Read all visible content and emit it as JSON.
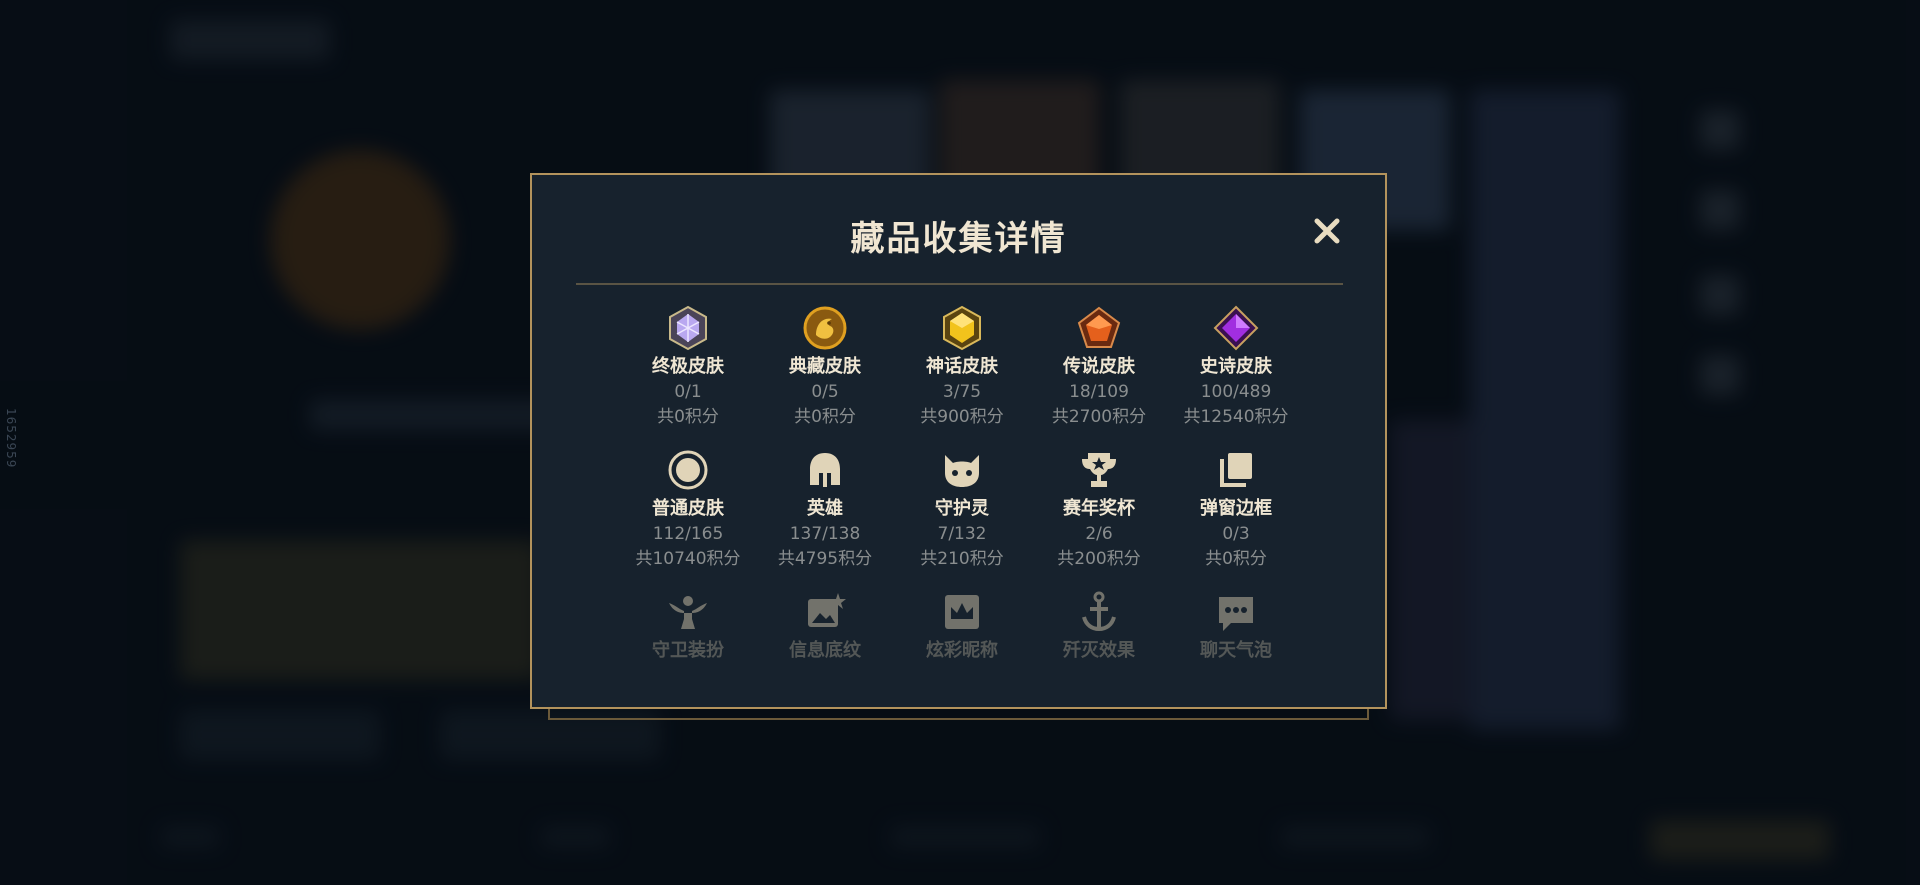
{
  "side_id": "1652959",
  "modal": {
    "title": "藏品收集详情",
    "close_icon": "close-icon"
  },
  "categories": [
    {
      "name": "终极皮肤",
      "count": "0/1",
      "points": "共0积分",
      "icon": "ultimate-gem-icon",
      "color": "#b9a8f0"
    },
    {
      "name": "典藏皮肤",
      "count": "0/5",
      "points": "共0积分",
      "icon": "dragon-coin-icon",
      "color": "#e0a020"
    },
    {
      "name": "神话皮肤",
      "count": "3/75",
      "points": "共900积分",
      "icon": "mythic-gem-icon",
      "color": "#f2c31c"
    },
    {
      "name": "传说皮肤",
      "count": "18/109",
      "points": "共2700积分",
      "icon": "legendary-gem-icon",
      "color": "#e5601c"
    },
    {
      "name": "史诗皮肤",
      "count": "100/489",
      "points": "共12540积分",
      "icon": "epic-gem-icon",
      "color": "#a12ee0"
    },
    {
      "name": "普通皮肤",
      "count": "112/165",
      "points": "共10740积分",
      "icon": "circle-icon",
      "color": "#e0d4b8"
    },
    {
      "name": "英雄",
      "count": "137/138",
      "points": "共4795积分",
      "icon": "helmet-icon",
      "color": "#e0d4b8"
    },
    {
      "name": "守护灵",
      "count": "7/132",
      "points": "共210积分",
      "icon": "little-legend-icon",
      "color": "#e0d4b8"
    },
    {
      "name": "赛年奖杯",
      "count": "2/6",
      "points": "共200积分",
      "icon": "trophy-icon",
      "color": "#e0d4b8"
    },
    {
      "name": "弹窗边框",
      "count": "0/3",
      "points": "共0积分",
      "icon": "frames-icon",
      "color": "#e0d4b8"
    },
    {
      "name": "守卫装扮",
      "icon": "ward-icon",
      "color": "#e0d4b8"
    },
    {
      "name": "信息底纹",
      "icon": "banner-icon",
      "color": "#e0d4b8"
    },
    {
      "name": "炫彩昵称",
      "icon": "crown-icon",
      "color": "#e0d4b8"
    },
    {
      "name": "歼灭效果",
      "icon": "anchor-icon",
      "color": "#e0d4b8"
    },
    {
      "name": "聊天气泡",
      "icon": "chat-bubble-icon",
      "color": "#e0d4b8"
    }
  ]
}
